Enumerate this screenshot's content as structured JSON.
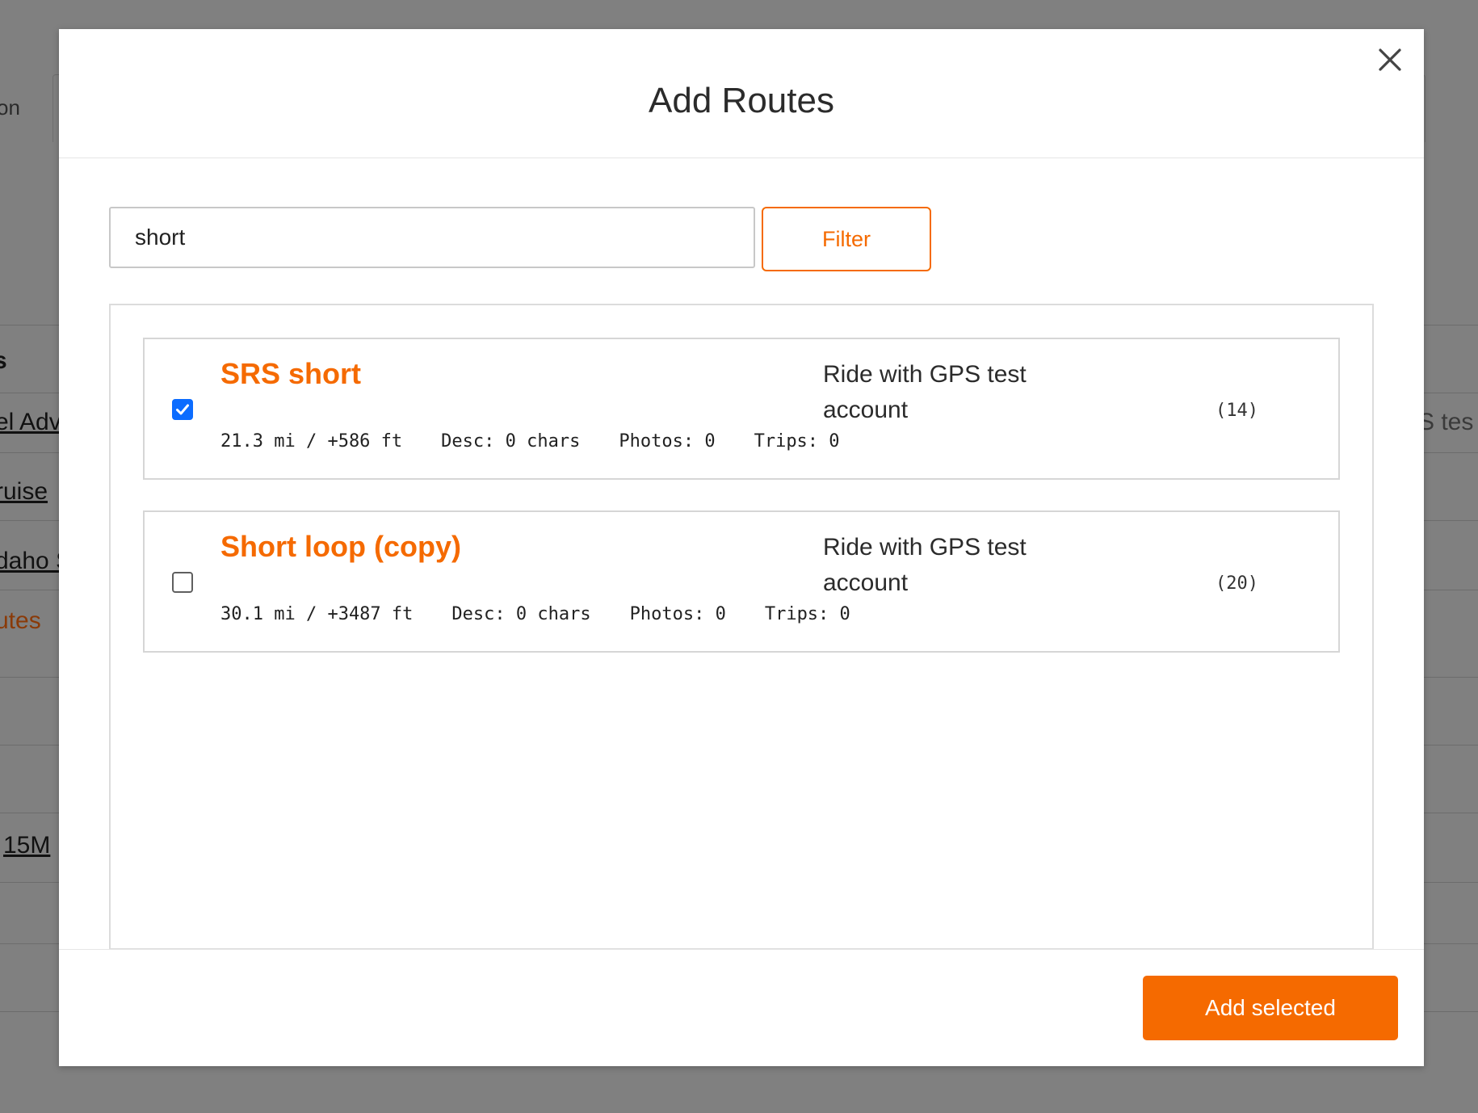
{
  "background": {
    "tab_fragment": "on",
    "header_fragment": "s",
    "rows": [
      {
        "text": "el Adv",
        "style": "link"
      },
      {
        "text": "ruise",
        "style": "link"
      },
      {
        "text": "daho S",
        "style": "link"
      },
      {
        "text": "utes",
        "style": "orange"
      },
      {
        "text": "15M",
        "style": "link"
      }
    ],
    "right_fragment": "S tes"
  },
  "modal": {
    "title": "Add Routes",
    "close_icon": "close-icon",
    "search": {
      "value": "short",
      "placeholder": ""
    },
    "filter_label": "Filter",
    "routes": [
      {
        "checked": true,
        "name": "SRS short",
        "distance": "21.3 mi / +586 ft",
        "desc": "Desc: 0 chars",
        "photos": "Photos: 0",
        "trips": "Trips: 0",
        "owner": "Ride with GPS test account",
        "count": "(14)"
      },
      {
        "checked": false,
        "name": "Short loop (copy)",
        "distance": "30.1 mi / +3487 ft",
        "desc": "Desc: 0 chars",
        "photos": "Photos: 0",
        "trips": "Trips: 0",
        "owner": "Ride with GPS test account",
        "count": "(20)"
      }
    ],
    "add_selected_label": "Add selected"
  },
  "colors": {
    "accent": "#f56a00",
    "checkbox": "#0b6cff",
    "overlay": "#808080"
  }
}
